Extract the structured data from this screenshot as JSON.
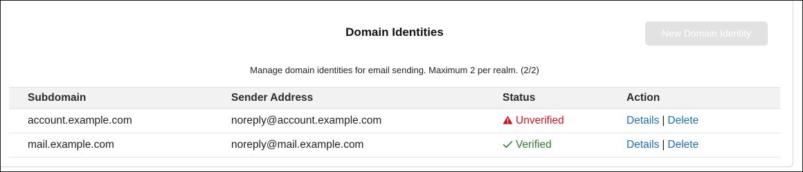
{
  "header": {
    "title": "Domain Identities",
    "new_button_label": "New Domain Identity",
    "subtitle": "Manage domain identities for email sending. Maximum 2 per realm. (2/2)"
  },
  "table": {
    "columns": [
      "Subdomain",
      "Sender Address",
      "Status",
      "Action"
    ],
    "rows": [
      {
        "subdomain": "account.example.com",
        "sender": "noreply@account.example.com",
        "status": "Unverified",
        "status_icon": "warning-triangle-icon",
        "details_label": "Details",
        "separator": "|",
        "delete_label": "Delete"
      },
      {
        "subdomain": "mail.example.com",
        "sender": "noreply@mail.example.com",
        "status": "Verified",
        "status_icon": "checkmark-icon",
        "details_label": "Details",
        "separator": "|",
        "delete_label": "Delete"
      }
    ]
  },
  "colors": {
    "unverified": "#d0111b",
    "verified": "#2a7d2e",
    "link": "#1670b8",
    "disabled_button": "#e2e2e2"
  }
}
